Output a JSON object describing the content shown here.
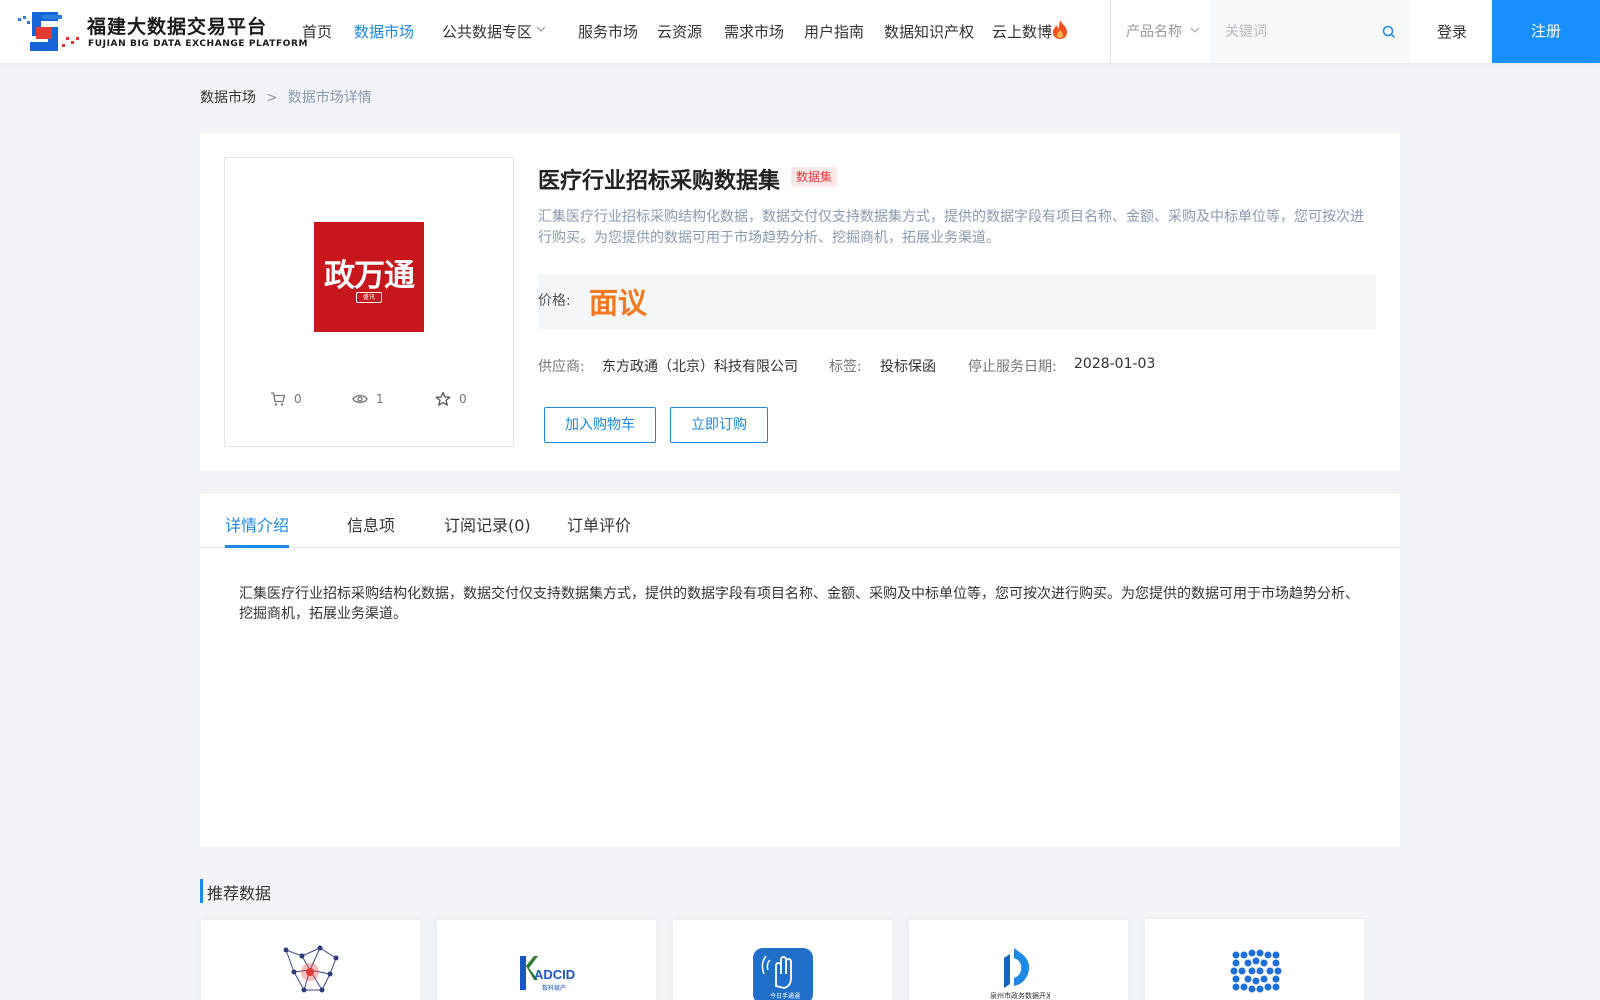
{
  "header": {
    "logo_cn": "福建大数据交易平台",
    "logo_en": "FUJIAN BIG DATA EXCHANGE  PLATFORM",
    "nav": [
      {
        "label": "首页"
      },
      {
        "label": "数据市场",
        "active": true
      },
      {
        "label": "公共数据专区"
      },
      {
        "label": "服务市场"
      },
      {
        "label": "云资源"
      },
      {
        "label": "需求市场"
      },
      {
        "label": "用户指南"
      },
      {
        "label": "数据知识产权"
      },
      {
        "label": "云上数博"
      }
    ],
    "search_category": "产品名称",
    "search_placeholder": "关键词",
    "login": "登录",
    "register": "注册",
    "accent": "#1890ff"
  },
  "breadcrumb": {
    "items": [
      "数据市场",
      "数据市场详情"
    ],
    "separator": ">"
  },
  "product": {
    "title": "医疗行业招标采购数据集",
    "type_tag": "数据集",
    "description": "汇集医疗行业招标采购结构化数据，数据交付仅支持数据集方式，提供的数据字段有项目名称、金额、采购及中标单位等，您可按次进行购买。为您提供的数据可用于市场趋势分析、挖掘商机，拓展业务渠道。",
    "logo_text": "政万通",
    "logo_badge": "盛讯",
    "price_label": "价格:",
    "price_value": "面议",
    "price_color": "#f47920",
    "supplier_label": "供应商:",
    "supplier": "东方政通（北京）科技有限公司",
    "tags_label": "标签:",
    "tags": "投标保函",
    "end_date_label": "停止服务日期:",
    "end_date": "2028-01-03",
    "stats": {
      "cart": "0",
      "views": "1",
      "favorites": "0"
    },
    "add_to_cart": "加入购物车",
    "subscribe": "立即订购"
  },
  "tabs": {
    "items": [
      "详情介绍",
      "信息项",
      "订阅记录(0)",
      "订单评价"
    ],
    "active_index": 0,
    "content": "汇集医疗行业招标采购结构化数据，数据交付仅支持数据集方式，提供的数据字段有项目名称、金额、采购及中标单位等，您可按次进行购买。为您提供的数据可用于市场趋势分析、挖掘商机，拓展业务渠道。"
  },
  "recommend": {
    "title": "推荐数据",
    "cards": [
      {
        "icon": "network-graph-logo"
      },
      {
        "icon": "adcid-logo"
      },
      {
        "icon": "hand-app-logo"
      },
      {
        "icon": "blue-d-logo"
      },
      {
        "icon": "blue-dots-logo"
      }
    ]
  }
}
